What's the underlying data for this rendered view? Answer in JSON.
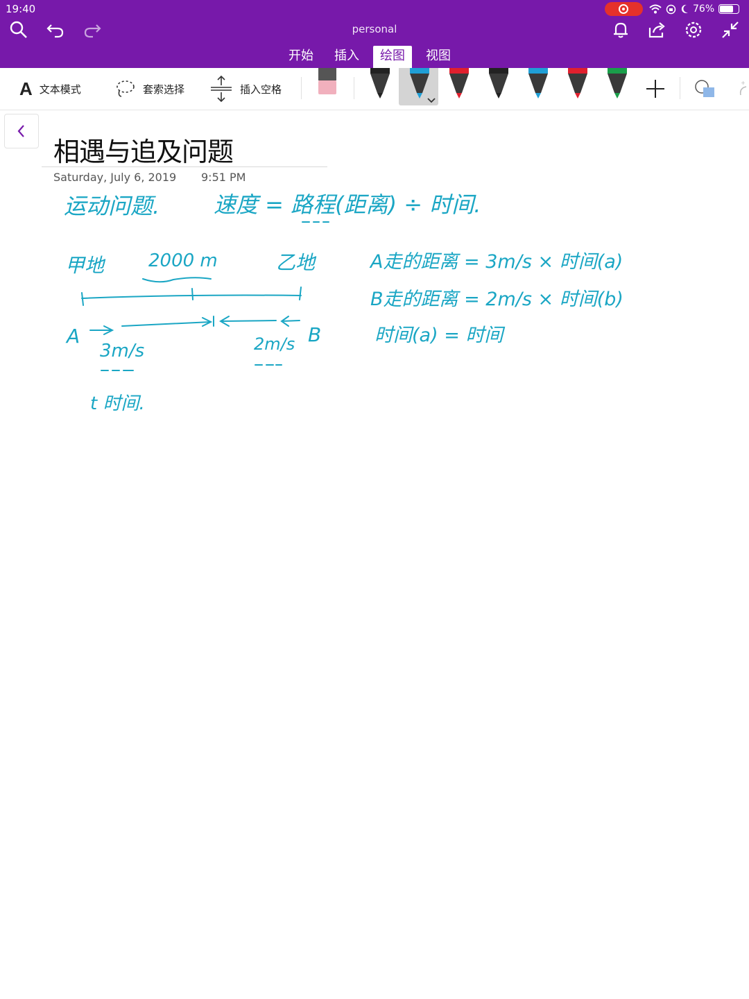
{
  "status": {
    "time": "19:40",
    "battery": "76%",
    "battery_level": 0.76
  },
  "header": {
    "notebook": "personal",
    "tabs": [
      {
        "label": "开始",
        "active": false
      },
      {
        "label": "插入",
        "active": false
      },
      {
        "label": "绘图",
        "active": true
      },
      {
        "label": "视图",
        "active": false
      }
    ]
  },
  "ribbon": {
    "text_mode": "文本模式",
    "lasso_select": "套索选择",
    "insert_space": "插入空格",
    "pens": [
      {
        "color": "#222222"
      },
      {
        "color": "#1f9fd6",
        "selected": true
      },
      {
        "color": "#e0202e"
      },
      {
        "color": "#222222"
      },
      {
        "color": "#1f9fd6"
      },
      {
        "color": "#e0202e"
      },
      {
        "color": "#1a9e4a"
      }
    ]
  },
  "page": {
    "title": "相遇与追及问题",
    "date": "Saturday, July 6, 2019",
    "time": "9:51 PM"
  },
  "ink": {
    "color": "#1aa6c4",
    "line1_left": "运动问题.",
    "line1_right": "速度 = 路程(距离) ÷ 时间.",
    "place_a": "甲地",
    "distance": "2000 m",
    "place_b": "乙地",
    "point_a": "A",
    "point_b": "B",
    "speed_a": "3m/s",
    "speed_b": "2m/s",
    "time_note": "t 时间.",
    "formula_a": "A走的距离 = 3m/s × 时间(a)",
    "formula_b": "B走的距离 = 2m/s × 时间(b)",
    "formula_eq": "时间(a) = 时间"
  }
}
